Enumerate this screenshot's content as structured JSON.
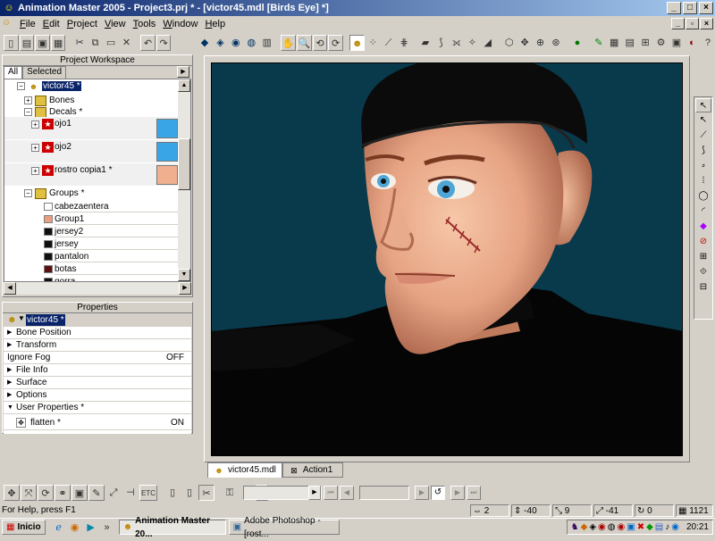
{
  "window": {
    "title": "Animation Master 2005 - Project3.prj * - [victor45.mdl [Birds Eye] *]"
  },
  "menu": [
    "File",
    "Edit",
    "Project",
    "View",
    "Tools",
    "Window",
    "Help"
  ],
  "project_workspace": {
    "title": "Project Workspace",
    "tabs": [
      "All",
      "Selected"
    ],
    "tree": {
      "root": "victor45 *",
      "bones": "Bones",
      "decals": "Decals *",
      "decal_items": [
        "ojo1",
        "ojo2",
        "rostro copia1 *"
      ],
      "groups": "Groups *",
      "group_items": [
        {
          "name": "cabezaentera",
          "color": "#ffffff"
        },
        {
          "name": "Group1",
          "color": "#e8a080"
        },
        {
          "name": "jersey2",
          "color": "#101010"
        },
        {
          "name": "jersey",
          "color": "#101010"
        },
        {
          "name": "pantalon",
          "color": "#101010"
        },
        {
          "name": "botas",
          "color": "#5a1010"
        },
        {
          "name": "gorra",
          "color": "#101010"
        }
      ]
    }
  },
  "properties": {
    "title": "Properties",
    "object": "victor45 *",
    "rows": [
      {
        "label": "Bone Position",
        "value": "",
        "expander": true
      },
      {
        "label": "Transform",
        "value": "",
        "expander": true
      },
      {
        "label": "Ignore Fog",
        "value": "OFF",
        "expander": false
      },
      {
        "label": "File Info",
        "value": "",
        "expander": true
      },
      {
        "label": "Surface",
        "value": "",
        "expander": true
      },
      {
        "label": "Options",
        "value": "",
        "expander": true
      },
      {
        "label": "User Properties *",
        "value": "",
        "expander": true
      }
    ],
    "user_prop": {
      "label": "flatten *",
      "value": "ON"
    }
  },
  "viewport": {
    "background": "#093a4c"
  },
  "bottom_tabs": [
    "victor45.mdl",
    "Action1"
  ],
  "status": {
    "help": "For Help, press F1",
    "coords": [
      "2",
      "-40",
      "9",
      "-41",
      "0",
      "1121"
    ]
  },
  "taskbar": {
    "start": "Inicio",
    "tasks": [
      "Animation Master 20...",
      "Adobe Photoshop - [rost..."
    ],
    "clock": "20:21"
  },
  "animbar": {
    "etc": "ETC"
  }
}
